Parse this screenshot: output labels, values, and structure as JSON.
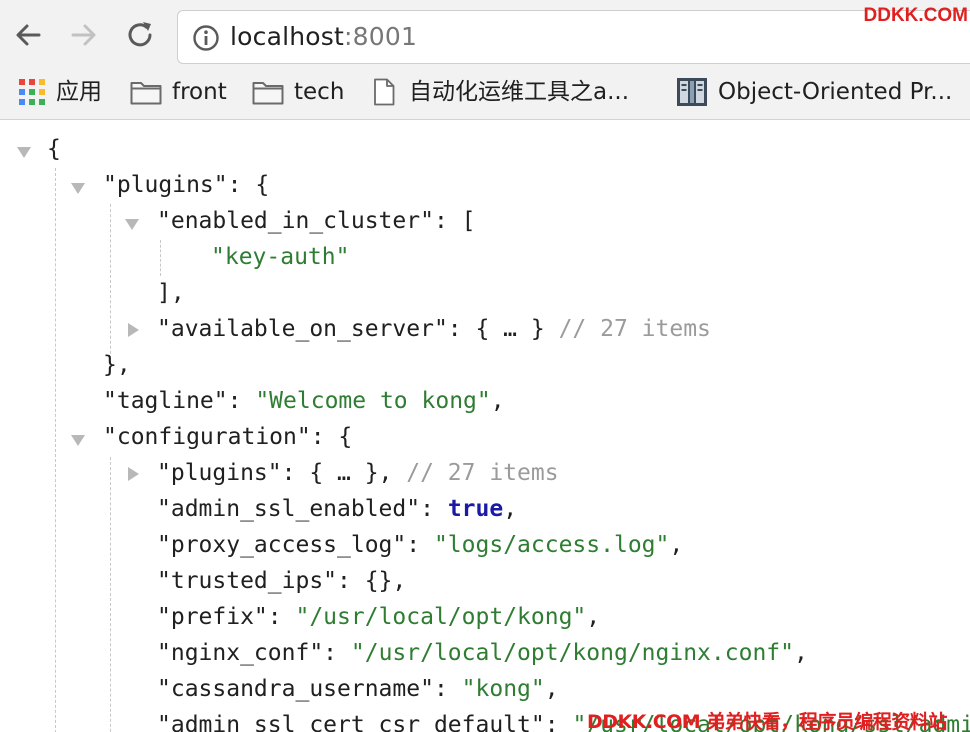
{
  "browser": {
    "url_host": "localhost",
    "url_port": ":8001",
    "watermark_top": "DDKK.COM"
  },
  "bookmarks": [
    {
      "label": "应用",
      "icon": "apps-grid-icon"
    },
    {
      "label": "front",
      "icon": "folder-icon"
    },
    {
      "label": "tech",
      "icon": "folder-icon"
    },
    {
      "label": "自动化运维工具之a...",
      "icon": "page-icon"
    },
    {
      "label": "Object-Oriented Pr...",
      "icon": "book-icon"
    }
  ],
  "json_view": {
    "root_open": "{",
    "plugins_key": "\"plugins\"",
    "plugins_sep": ": {",
    "enabled_key": "\"enabled_in_cluster\"",
    "enabled_sep": ": [",
    "enabled_value": "\"key-auth\"",
    "enabled_close": "],",
    "available_key": "\"available_on_server\"",
    "available_sep": ": { … }",
    "available_comment": " // 27 items",
    "plugins_close": "},",
    "tagline_key": "\"tagline\"",
    "tagline_sep": ": ",
    "tagline_value": "\"Welcome to kong\"",
    "tagline_end": ",",
    "configuration_key": "\"configuration\"",
    "configuration_sep": ": {",
    "conf_plugins_key": "\"plugins\"",
    "conf_plugins_sep": ": { … },",
    "conf_plugins_comment": " // 27 items",
    "admin_ssl_key": "\"admin_ssl_enabled\"",
    "admin_ssl_sep": ": ",
    "admin_ssl_value": "true",
    "admin_ssl_end": ",",
    "proxy_key": "\"proxy_access_log\"",
    "proxy_sep": ": ",
    "proxy_value": "\"logs/access.log\"",
    "proxy_end": ",",
    "trusted_key": "\"trusted_ips\"",
    "trusted_sep": ": {},",
    "prefix_key": "\"prefix\"",
    "prefix_sep": ": ",
    "prefix_value": "\"/usr/local/opt/kong\"",
    "prefix_end": ",",
    "nginx_key": "\"nginx_conf\"",
    "nginx_sep": ": ",
    "nginx_value": "\"/usr/local/opt/kong/nginx.conf\"",
    "nginx_end": ",",
    "cass_key": "\"cassandra_username\"",
    "cass_sep": ": ",
    "cass_value": "\"kong\"",
    "cass_end": ",",
    "admin_cert_key": "\"admin_ssl_cert_csr_default\"",
    "admin_cert_sep": ": ",
    "admin_cert_value": "\"/usr/local/opt/kong/ssl/admin-kong-default.csr\"",
    "watermark_bottom": "DDKK.COM 弟弟快看，程序员编程资料站"
  },
  "colors": {
    "string": "#2e7d32",
    "keyword": "#1a1aa6",
    "comment": "#9b9b9b",
    "watermark": "#e02020"
  }
}
